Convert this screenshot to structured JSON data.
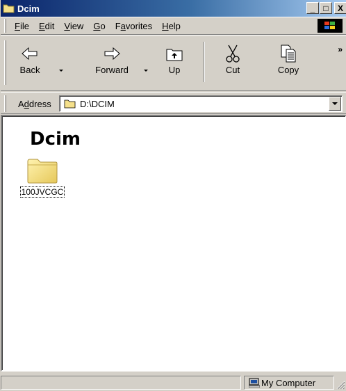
{
  "window": {
    "title": "Dcim",
    "buttons": {
      "minimize": "_",
      "maximize": "□",
      "close": "X"
    }
  },
  "menubar": {
    "items": [
      {
        "label": "File",
        "accel": "F",
        "rest": "ile"
      },
      {
        "label": "Edit",
        "accel": "E",
        "rest": "dit"
      },
      {
        "label": "View",
        "accel": "V",
        "rest": "iew"
      },
      {
        "label": "Go",
        "accel": "G",
        "rest": "o"
      },
      {
        "label": "Favorites",
        "pre": "F",
        "accel": "a",
        "rest": "vorites"
      },
      {
        "label": "Help",
        "accel": "H",
        "rest": "elp"
      }
    ]
  },
  "toolbar": {
    "back_label": "Back",
    "forward_label": "Forward",
    "up_label": "Up",
    "cut_label": "Cut",
    "copy_label": "Copy",
    "more_label": "»"
  },
  "address": {
    "label_pre": "A",
    "label_accel": "d",
    "label_rest": "dress",
    "value": "D:\\DCIM"
  },
  "content": {
    "heading": "Dcim",
    "items": [
      {
        "name": "100JVCGC",
        "type": "folder"
      }
    ]
  },
  "statusbar": {
    "zone": "My Computer"
  },
  "colors": {
    "titlebar_start": "#0a246a",
    "titlebar_end": "#a6caf0",
    "face": "#d4d0c8",
    "folder": "#f5e08a"
  }
}
